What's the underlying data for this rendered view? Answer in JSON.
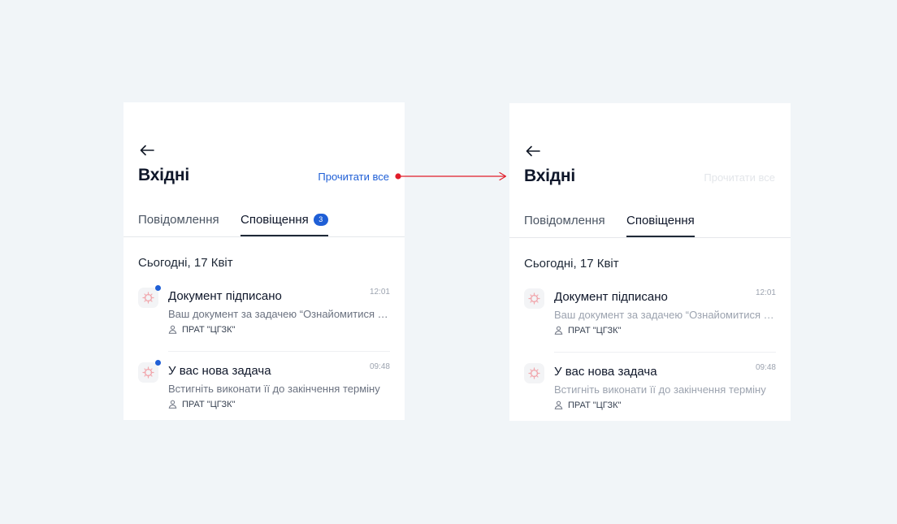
{
  "colors": {
    "background": "#f1f5f8",
    "accent": "#1f5fd6",
    "connector": "#e11d2a",
    "disabled_link": "#e3e6ea"
  },
  "before": {
    "title": "Вхідні",
    "read_all": "Прочитати все",
    "tabs": [
      {
        "label": "Повідомлення",
        "active": false
      },
      {
        "label": "Сповіщення",
        "active": true,
        "badge": "3"
      }
    ],
    "date_header": "Сьогодні, 17 Квіт",
    "notifications": [
      {
        "title": "Документ підписано",
        "time": "12:01",
        "body": "Ваш документ за задачею “Ознайомитися з положенням”",
        "org": "ПРАТ \"ЦГЗК\"",
        "unread": true
      },
      {
        "title": "У вас нова задача",
        "time": "09:48",
        "body": "Встигніть виконати її до закінчення терміну",
        "org": "ПРАТ \"ЦГЗК\"",
        "unread": true
      }
    ]
  },
  "after": {
    "title": "Вхідні",
    "read_all": "Прочитати все",
    "tabs": [
      {
        "label": "Повідомлення",
        "active": false
      },
      {
        "label": "Сповіщення",
        "active": true
      }
    ],
    "date_header": "Сьогодні, 17 Квіт",
    "notifications": [
      {
        "title": "Документ підписано",
        "time": "12:01",
        "body": "Ваш документ за задачею “Ознайомитися з положенням”",
        "org": "ПРАТ \"ЦГЗК\"",
        "unread": false
      },
      {
        "title": "У вас нова задача",
        "time": "09:48",
        "body": "Встигніть виконати її до закінчення терміну",
        "org": "ПРАТ \"ЦГЗК\"",
        "unread": false
      }
    ]
  },
  "icons": {
    "back": "arrow-left-icon",
    "notification": "doc-logo-icon",
    "org": "person-icon"
  }
}
